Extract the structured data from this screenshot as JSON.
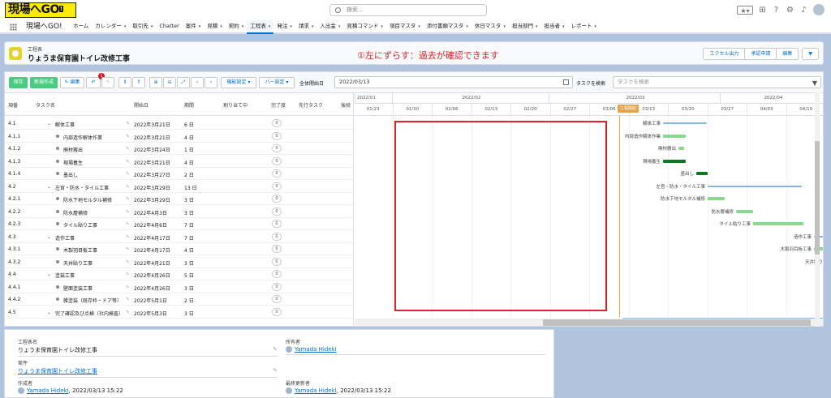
{
  "brand": {
    "logo_main": "現場へ",
    "logo_go": "GO",
    "logo_sub": "!"
  },
  "search": {
    "placeholder": "検索..."
  },
  "nav": {
    "app_name": "現場へGO!",
    "items": [
      {
        "label": "ホーム",
        "dd": false
      },
      {
        "label": "カレンダー",
        "dd": true
      },
      {
        "label": "取引先",
        "dd": true
      },
      {
        "label": "Chatter",
        "dd": false
      },
      {
        "label": "案件",
        "dd": true
      },
      {
        "label": "見積",
        "dd": true
      },
      {
        "label": "契約",
        "dd": true
      },
      {
        "label": "工程表",
        "dd": true,
        "active": true
      },
      {
        "label": "発注",
        "dd": true
      },
      {
        "label": "請求",
        "dd": true
      },
      {
        "label": "入出金",
        "dd": true
      },
      {
        "label": "見積コマンド",
        "dd": true
      },
      {
        "label": "項目マスタ",
        "dd": true
      },
      {
        "label": "添付書類マスタ",
        "dd": true
      },
      {
        "label": "休日マスタ",
        "dd": true
      },
      {
        "label": "担当部門",
        "dd": true
      },
      {
        "label": "担当者",
        "dd": true
      },
      {
        "label": "レポート",
        "dd": true
      }
    ]
  },
  "header": {
    "object": "工程表",
    "title": "りょうま保育園トイレ改修工事",
    "btn_excel": "エクセル出力",
    "btn_approval": "承認申請",
    "btn_edit": "編集",
    "btn_more": "▼"
  },
  "annotation": "①左にずらす：過去が確認できます",
  "toolbar": {
    "save": "保存",
    "new": "新規作成",
    "edit": "✎ 編集",
    "undo": "↶",
    "redo": "↷",
    "undo_badge": "1",
    "b_expand": "⇕",
    "b_collapse": "⇑",
    "b_zoomin": "⊕",
    "b_zoomout": "⊖",
    "b_fit": "⤢",
    "b_prev": "‹",
    "b_next": "›",
    "func": "機能設定 ▾",
    "bar": "バー設定 ▾",
    "overall_start_label": "全体開始日",
    "date_value": "2022/03/13",
    "task_search_label": "タスクを検索",
    "task_search_placeholder": "タスクを検索"
  },
  "columns": {
    "no": "項番",
    "task": "タスク名",
    "start": "開始日",
    "duration": "期間",
    "assign": "割り当て中",
    "done": "完了度",
    "pred": "先行タスク",
    "succ": "後続"
  },
  "rows": [
    {
      "no": "4.1",
      "task": "解体工事",
      "start": "2022年3月21日",
      "dur": "6 日",
      "level": 1
    },
    {
      "no": "4.1.1",
      "task": "内部造作解体作業",
      "start": "2022年3月21日",
      "dur": "4 日",
      "level": 2
    },
    {
      "no": "4.1.2",
      "task": "廃材搬出",
      "start": "2022年3月24日",
      "dur": "1 日",
      "level": 2
    },
    {
      "no": "4.1.3",
      "task": "現場養生",
      "start": "2022年3月21日",
      "dur": "4 日",
      "level": 2
    },
    {
      "no": "4.1.4",
      "task": "墨出し",
      "start": "2022年3月27日",
      "dur": "2 日",
      "level": 2
    },
    {
      "no": "4.2",
      "task": "左官・防水・タイル工事",
      "start": "2022年3月29日",
      "dur": "13 日",
      "level": 1
    },
    {
      "no": "4.2.1",
      "task": "防水下地モルタル補修",
      "start": "2022年3月29日",
      "dur": "3 日",
      "level": 2
    },
    {
      "no": "4.2.2",
      "task": "防水層補修",
      "start": "2022年4月3日",
      "dur": "3 日",
      "level": 2
    },
    {
      "no": "4.2.3",
      "task": "タイル貼り工事",
      "start": "2022年4月6日",
      "dur": "7 日",
      "level": 2
    },
    {
      "no": "4.3",
      "task": "造作工事",
      "start": "2022年4月17日",
      "dur": "7 日",
      "level": 1
    },
    {
      "no": "4.3.1",
      "task": "木製羽目板工事",
      "start": "2022年4月17日",
      "dur": "4 日",
      "level": 2
    },
    {
      "no": "4.3.2",
      "task": "天井貼り工事",
      "start": "2022年4月21日",
      "dur": "3 日",
      "level": 2
    },
    {
      "no": "4.4",
      "task": "塗装工事",
      "start": "2022年4月26日",
      "dur": "5 日",
      "level": 1
    },
    {
      "no": "4.4.1",
      "task": "壁面塗装工事",
      "start": "2022年4月26日",
      "dur": "3 日",
      "level": 2
    },
    {
      "no": "4.4.2",
      "task": "雑塗装（既存枠・ドア等）",
      "start": "2022年5月1日",
      "dur": "2 日",
      "level": 2
    },
    {
      "no": "4.5",
      "task": "完了確認及び点検（社内検査）",
      "start": "2022年5月3日",
      "dur": "3 日",
      "level": 1
    }
  ],
  "done_value": "0",
  "timeline": {
    "months": [
      "2022/01",
      "2022/02",
      "2022/03",
      "2022/04"
    ],
    "weeks": [
      "01/23",
      "01/30",
      "02/06",
      "02/13",
      "02/20",
      "02/27",
      "03/06",
      "03/13",
      "03/20",
      "03/27",
      "04/03",
      "04/10"
    ],
    "today_label": "工程開始"
  },
  "gantt_labels": [
    "解体工事",
    "内部造作解体作業",
    "廃材搬出",
    "現場養生",
    "墨出し",
    "左官・防水・タイル工事",
    "防水下地モルタル補修",
    "防水層補修",
    "タイル貼り工事",
    "造作工事",
    "木製羽目板工事",
    "天井貼り"
  ],
  "detail": {
    "f1_label": "工程表名",
    "f1_value": "りょうま保育園トイレ改修工事",
    "f2_label": "所有者",
    "f2_value": "Yamada Hideki",
    "f3_label": "案件",
    "f3_value": "りょうま保育園トイレ改修工事",
    "f4_label": "作成者",
    "f4_user": "Yamada Hideki",
    "f4_date": ", 2022/03/13 15:22",
    "f5_label": "最終更新者",
    "f5_user": "Yamada Hideki",
    "f5_date": ", 2022/03/13 15:22"
  }
}
